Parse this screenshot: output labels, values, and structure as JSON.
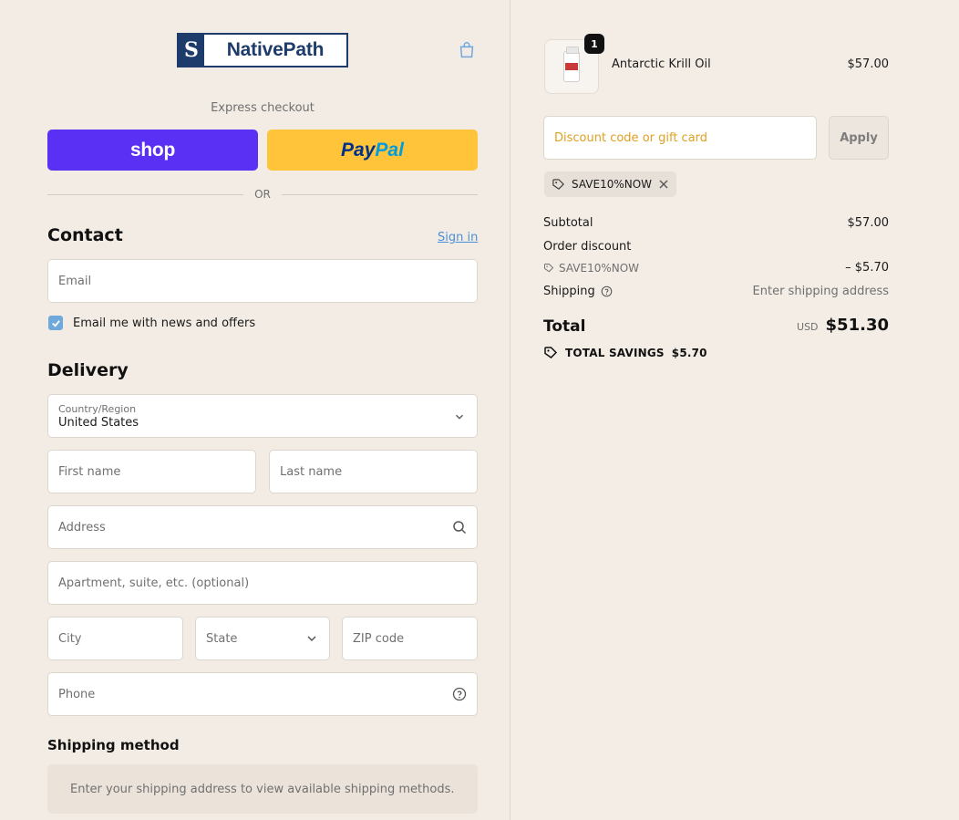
{
  "brand": {
    "logo_letter": "S",
    "logo_text": "NativePath"
  },
  "express": {
    "label": "Express checkout",
    "shop_label": "shop",
    "paypal_part1": "Pay",
    "paypal_part2": "Pal",
    "or_text": "OR"
  },
  "contact": {
    "heading": "Contact",
    "signin_label": "Sign in",
    "email_placeholder": "Email",
    "newsletter_label": "Email me with news and offers",
    "newsletter_checked": true
  },
  "delivery": {
    "heading": "Delivery",
    "country_label": "Country/Region",
    "country_value": "United States",
    "first_name_placeholder": "First name",
    "last_name_placeholder": "Last name",
    "address_placeholder": "Address",
    "apartment_placeholder": "Apartment, suite, etc. (optional)",
    "city_placeholder": "City",
    "state_placeholder": "State",
    "zip_placeholder": "ZIP code",
    "phone_placeholder": "Phone"
  },
  "shipping_method": {
    "heading": "Shipping method",
    "message": "Enter your shipping address to view available shipping methods."
  },
  "order": {
    "item": {
      "name": "Antarctic Krill Oil",
      "price": "$57.00",
      "quantity": "1"
    },
    "discount_placeholder": "Discount code or gift card",
    "apply_label": "Apply",
    "applied_code": "SAVE10%NOW",
    "subtotal_label": "Subtotal",
    "subtotal_value": "$57.00",
    "order_discount_label": "Order discount",
    "discount_code": "SAVE10%NOW",
    "discount_value": "– $5.70",
    "shipping_label": "Shipping",
    "shipping_value": "Enter shipping address",
    "total_label": "Total",
    "total_currency": "USD",
    "total_value": "$51.30",
    "savings_label": "TOTAL SAVINGS",
    "savings_value": "$5.70"
  },
  "colors": {
    "shop_purple": "#5a31f4",
    "paypal_yellow": "#ffc439",
    "link_blue": "#4a90d9",
    "checkbox_blue": "#6fa8dc",
    "discount_placeholder": "#e0a020"
  }
}
